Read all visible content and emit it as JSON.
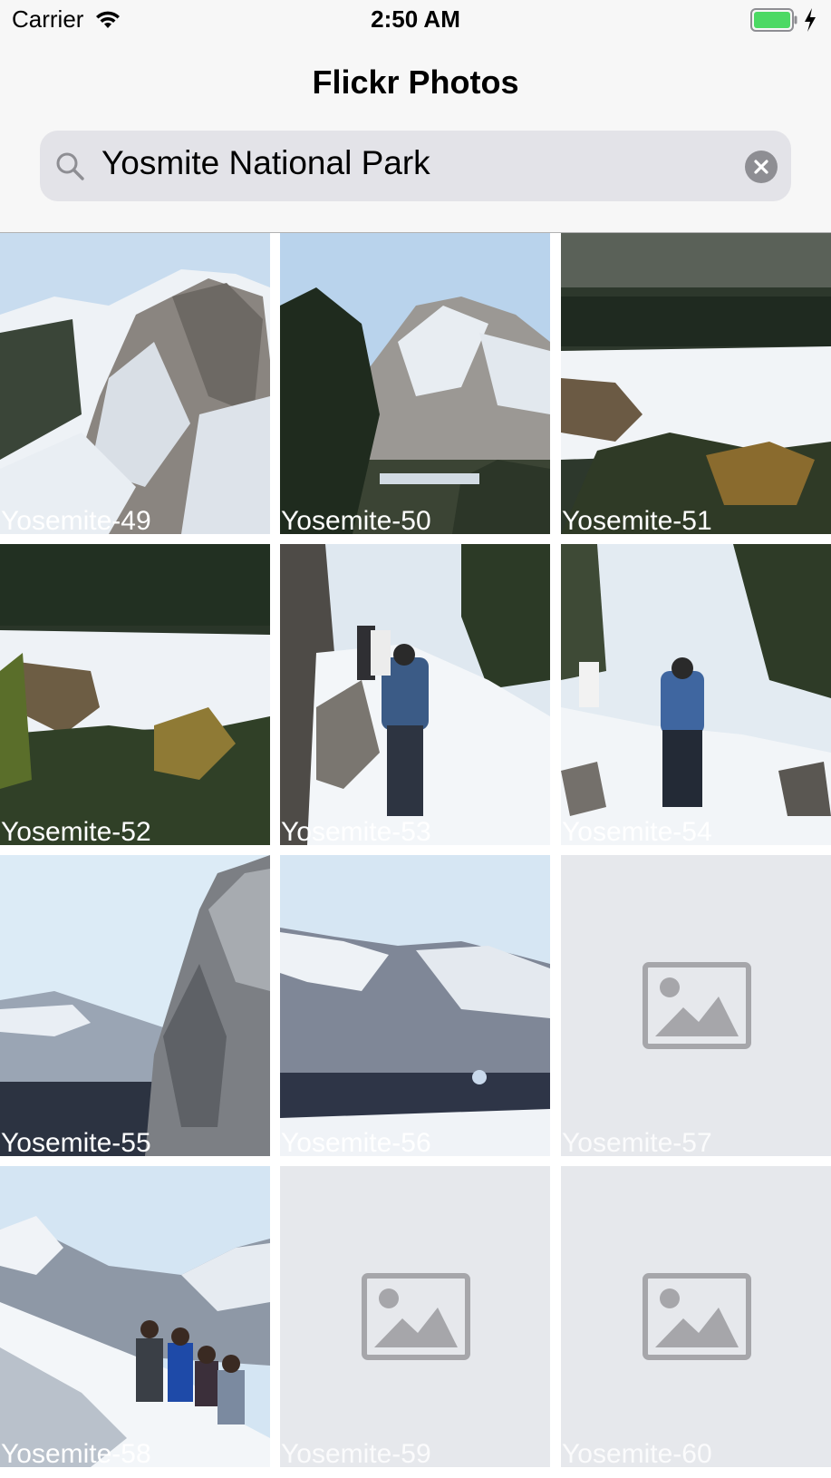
{
  "status_bar": {
    "carrier": "Carrier",
    "time": "2:50 AM",
    "icons": [
      "wifi-icon",
      "battery-icon",
      "charging-bolt-icon"
    ]
  },
  "nav": {
    "title": "Flickr Photos"
  },
  "search": {
    "value": "Yosmite National Park",
    "icon": "search-icon",
    "clear_icon": "clear-icon"
  },
  "photos": [
    {
      "title": "Yosemite-49",
      "loaded": true,
      "scene": "granite-peak"
    },
    {
      "title": "Yosemite-50",
      "loaded": true,
      "scene": "mountain-with-trees"
    },
    {
      "title": "Yosemite-51",
      "loaded": true,
      "scene": "snowy-meadow"
    },
    {
      "title": "Yosemite-52",
      "loaded": true,
      "scene": "snowy-meadow-river"
    },
    {
      "title": "Yosemite-53",
      "loaded": true,
      "scene": "hikers-snow-trail"
    },
    {
      "title": "Yosemite-54",
      "loaded": true,
      "scene": "hiker-snow-slope"
    },
    {
      "title": "Yosemite-55",
      "loaded": true,
      "scene": "cliff-and-valley"
    },
    {
      "title": "Yosemite-56",
      "loaded": true,
      "scene": "mountain-range"
    },
    {
      "title": "Yosemite-57",
      "loaded": false,
      "scene": "image-placeholder-icon"
    },
    {
      "title": "Yosemite-58",
      "loaded": true,
      "scene": "group-half-dome"
    },
    {
      "title": "Yosemite-59",
      "loaded": false,
      "scene": "image-placeholder-icon"
    },
    {
      "title": "Yosemite-60",
      "loaded": false,
      "scene": "image-placeholder-icon"
    }
  ],
  "colors": {
    "header_bg": "#f7f7f7",
    "search_field_bg": "#e3e3e8",
    "placeholder_bg": "#e6e8ec",
    "placeholder_icon": "#a6a6aa",
    "battery_green": "#4cd964",
    "sky": "#cfe2f3",
    "snow": "#f3f6fa",
    "rock": "#6f6b68",
    "forest": "#2c3a2a"
  }
}
